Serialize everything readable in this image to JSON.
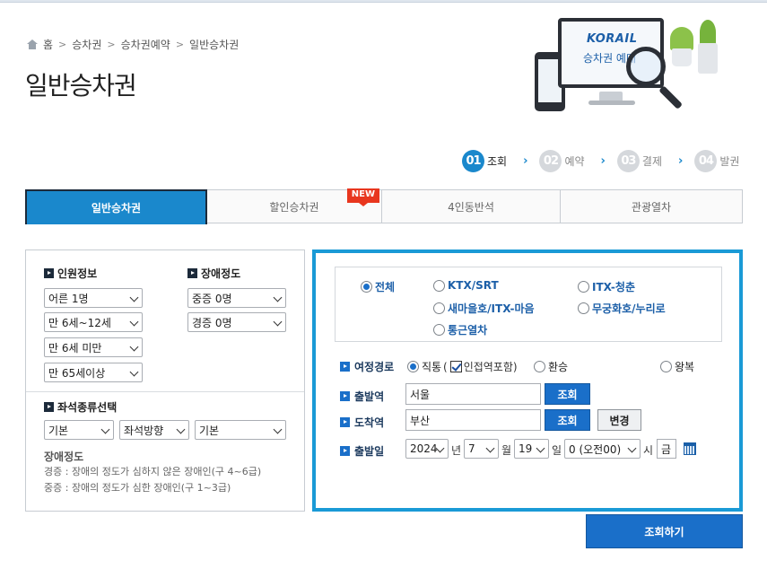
{
  "breadcrumb": {
    "items": [
      "홈",
      "승차권",
      "승차권예약",
      "일반승차권"
    ]
  },
  "page_title": "일반승차권",
  "hero": {
    "logo": "KORAIL",
    "subtitle": "승차권 예매"
  },
  "steps": [
    {
      "num": "01",
      "label": "조회",
      "active": true
    },
    {
      "num": "02",
      "label": "예약",
      "active": false
    },
    {
      "num": "03",
      "label": "결제",
      "active": false
    },
    {
      "num": "04",
      "label": "발권",
      "active": false
    }
  ],
  "tabs": [
    {
      "label": "일반승차권",
      "active": true
    },
    {
      "label": "할인승차권",
      "badge": "NEW"
    },
    {
      "label": "4인동반석"
    },
    {
      "label": "관광열차"
    }
  ],
  "passenger": {
    "title": "인원정보",
    "adult": "어른 1명",
    "child": "만 6세~12세",
    "infant": "만 6세 미만",
    "senior": "만 65세이상"
  },
  "disability": {
    "title": "장애정도",
    "severe": "중증 0명",
    "mild": "경증 0명"
  },
  "seat": {
    "title": "좌석종류선택",
    "type": "기본",
    "direction": "좌석방향",
    "option": "기본"
  },
  "note": {
    "title": "장애정도",
    "mild": "경증 : 장애의 정도가 심하지 않은 장애인(구 4~6급)",
    "severe": "중증 : 장애의 정도가 심한 장애인(구 1~3급)"
  },
  "train_types": {
    "all": "전체",
    "ktx": "KTX/SRT",
    "itx_cheongchun": "ITX-청춘",
    "saemaeul": "새마을호/ITX-마음",
    "mugunghwa": "무궁화호/누리로",
    "commuter": "통근열차"
  },
  "route": {
    "label": "여정경로",
    "direct": "직통",
    "nearby_open": "(",
    "nearby": "인접역포함)",
    "transfer": "환승",
    "round_trip": "왕복"
  },
  "departure": {
    "label": "출발역",
    "value": "서울",
    "button": "조회"
  },
  "arrival": {
    "label": "도착역",
    "value": "부산",
    "button": "조회",
    "swap_button": "변경"
  },
  "date": {
    "label": "출발일",
    "year": "2024",
    "year_unit": "년",
    "month": "7",
    "month_unit": "월",
    "day": "19",
    "day_unit": "일",
    "hour": "0 (오전00)",
    "hour_unit": "시",
    "weekday": "금"
  },
  "search_button": "조회하기",
  "colors": {
    "accent": "#1a88cc",
    "button": "#1a6fc9",
    "new_badge": "#e8361e"
  }
}
